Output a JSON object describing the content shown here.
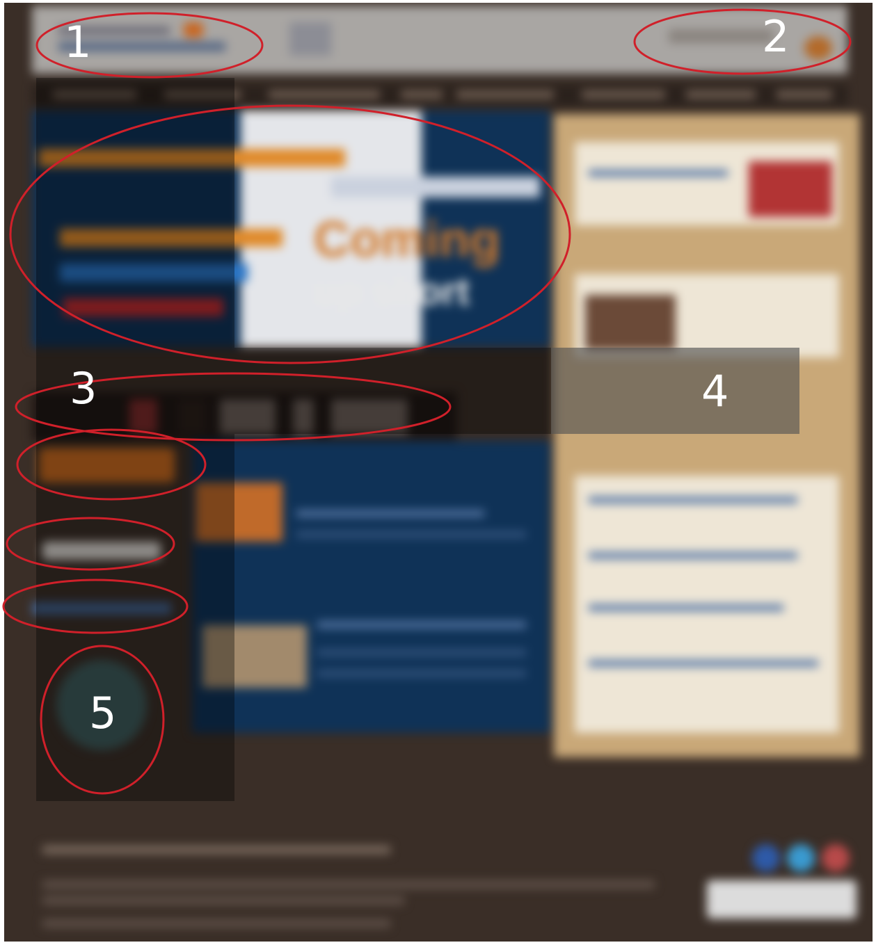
{
  "annotations": {
    "region_1": "1",
    "region_2": "2",
    "region_3": "3",
    "region_4": "4",
    "region_5": "5"
  },
  "hero": {
    "coming": "Coming",
    "up_short": "up short"
  },
  "colors": {
    "page_bg": "#3a2e27",
    "header_bg": "#a9a6a3",
    "hero_blue": "#0f3257",
    "accent_orange": "#c4681f",
    "sidebar_tan": "#c9a878",
    "annotation_red": "#d0202a"
  }
}
